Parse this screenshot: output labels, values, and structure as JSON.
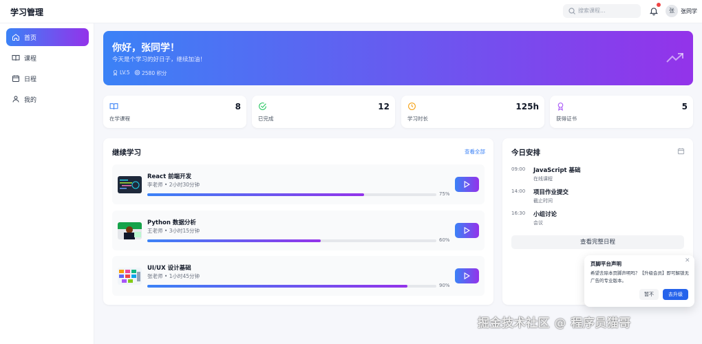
{
  "app": {
    "title": "学习管理"
  },
  "header": {
    "search_placeholder": "搜索课程...",
    "avatar_alt": "张",
    "username": "张同学"
  },
  "sidebar": {
    "items": [
      {
        "label": "首页",
        "icon": "home-icon",
        "active": true
      },
      {
        "label": "课程",
        "icon": "book-icon"
      },
      {
        "label": "日程",
        "icon": "calendar-icon"
      },
      {
        "label": "我的",
        "icon": "user-icon"
      }
    ]
  },
  "hero": {
    "greeting": "你好，张同学！",
    "subtitle": "今天是个学习的好日子，继续加油！",
    "level": "LV.5",
    "points": "2580 积分",
    "colors": {
      "from": "#3b82f6",
      "to": "#9333ea"
    }
  },
  "stats": [
    {
      "label": "在学课程",
      "value": "8",
      "icon": "book-icon",
      "color": "#3b82f6"
    },
    {
      "label": "已完成",
      "value": "12",
      "icon": "check-circle-icon",
      "color": "#22c55e"
    },
    {
      "label": "学习时长",
      "value": "125h",
      "icon": "clock-icon",
      "color": "#f59e0b"
    },
    {
      "label": "获得证书",
      "value": "5",
      "icon": "award-icon",
      "color": "#a855f7"
    }
  ],
  "continue_learning": {
    "title": "继续学习",
    "view_all": "查看全部",
    "courses": [
      {
        "title": "React 前端开发",
        "meta": "李老师 • 2小时30分钟",
        "progress": 75,
        "progress_label": "75%"
      },
      {
        "title": "Python 数据分析",
        "meta": "王老师 • 3小时15分钟",
        "progress": 60,
        "progress_label": "60%"
      },
      {
        "title": "UI/UX 设计基础",
        "meta": "张老师 • 1小时45分钟",
        "progress": 90,
        "progress_label": "90%"
      }
    ]
  },
  "schedule": {
    "title": "今日安排",
    "items": [
      {
        "time": "09:00",
        "title": "JavaScript 基础",
        "sub": "在线课程"
      },
      {
        "time": "14:00",
        "title": "项目作业提交",
        "sub": "截止时间"
      },
      {
        "time": "16:30",
        "title": "小组讨论",
        "sub": "会议"
      }
    ],
    "button": "查看完整日程"
  },
  "notice": {
    "title": "页脚平台声明",
    "body": "希望去除本页脚声明吗？【升级会员】即可解锁无广告的专业版本。",
    "later": "暂不",
    "upgrade": "去升级"
  },
  "watermark": "掘金技术社区 @ 程序员猫哥"
}
